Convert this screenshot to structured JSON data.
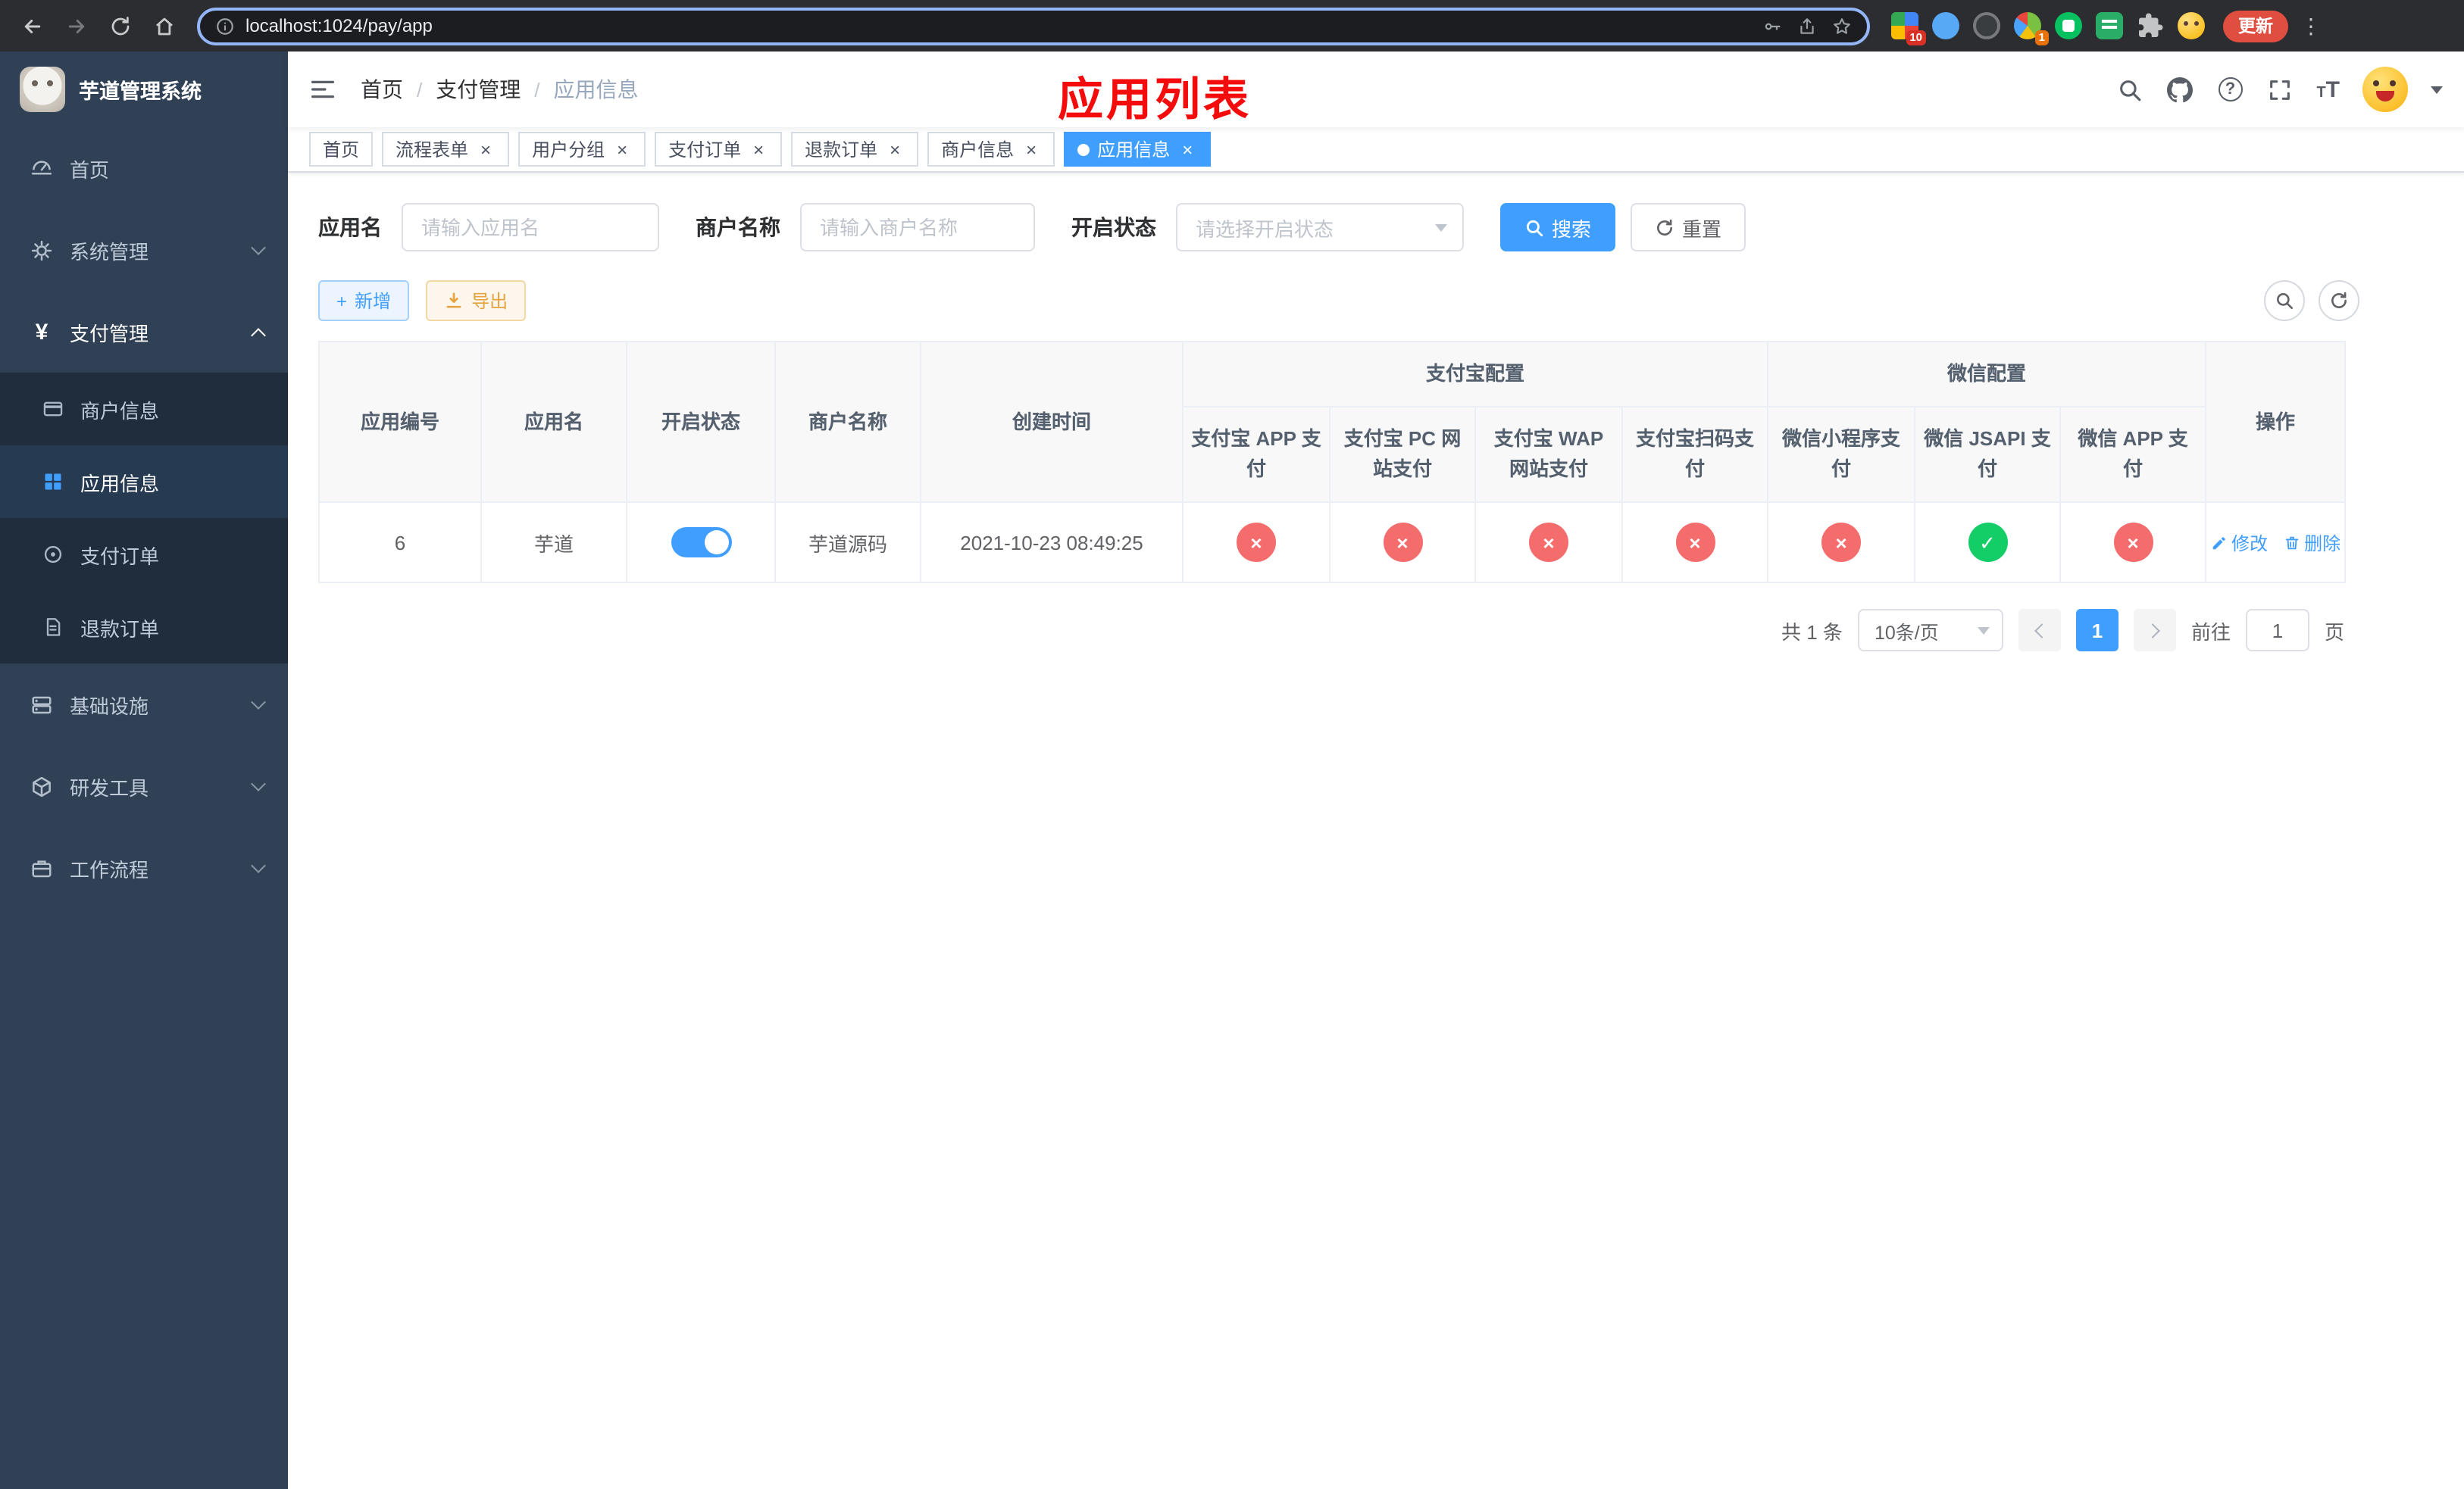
{
  "colors": {
    "accent": "#409eff",
    "danger": "#f56c6c",
    "success": "#13ce66",
    "warning": "#e6a23c",
    "annotation_red": "#f40b0b",
    "sidebar_bg": "#304156",
    "submenu_bg": "#1f2d3d"
  },
  "browser": {
    "url": "localhost:1024/pay/app",
    "update_button": "更新",
    "grid_ext_badge": "10",
    "circle_ext_badge": "1"
  },
  "sidebar": {
    "title": "芋道管理系统",
    "menu": [
      {
        "label": "首页",
        "icon": "dashboard-icon"
      },
      {
        "label": "系统管理",
        "icon": "gear-icon"
      },
      {
        "label": "支付管理",
        "icon": "yen-icon",
        "expanded": true
      },
      {
        "label": "基础设施",
        "icon": "infra-icon"
      },
      {
        "label": "研发工具",
        "icon": "tools-icon"
      },
      {
        "label": "工作流程",
        "icon": "workflow-icon"
      }
    ],
    "submenu": [
      {
        "label": "商户信息",
        "icon": "merchant-card-icon",
        "active": false
      },
      {
        "label": "应用信息",
        "icon": "app-grid-icon",
        "active": true
      },
      {
        "label": "支付订单",
        "icon": "order-icon",
        "active": false
      },
      {
        "label": "退款订单",
        "icon": "refund-doc-icon",
        "active": false
      }
    ]
  },
  "navbar": {
    "breadcrumb": [
      "首页",
      "支付管理",
      "应用信息"
    ],
    "annotation_title": "应用列表"
  },
  "tabs": [
    {
      "label": "首页",
      "closable": false,
      "active": false
    },
    {
      "label": "流程表单",
      "closable": true,
      "active": false
    },
    {
      "label": "用户分组",
      "closable": true,
      "active": false
    },
    {
      "label": "支付订单",
      "closable": true,
      "active": false
    },
    {
      "label": "退款订单",
      "closable": true,
      "active": false
    },
    {
      "label": "商户信息",
      "closable": true,
      "active": false
    },
    {
      "label": "应用信息",
      "closable": true,
      "active": true
    }
  ],
  "filters": {
    "app_name": {
      "label": "应用名",
      "placeholder": "请输入应用名"
    },
    "merchant_name": {
      "label": "商户名称",
      "placeholder": "请输入商户名称"
    },
    "status": {
      "label": "开启状态",
      "placeholder": "请选择开启状态"
    },
    "search_button": "搜索",
    "reset_button": "重置"
  },
  "toolbar": {
    "add_button": "新增",
    "export_button": "导出"
  },
  "table": {
    "headers": {
      "app_id": "应用编号",
      "app_name": "应用名",
      "status": "开启状态",
      "merchant": "商户名称",
      "created": "创建时间",
      "alipay_group": "支付宝配置",
      "wechat_group": "微信配置",
      "alipay_app": "支付宝 APP 支付",
      "alipay_pc": "支付宝 PC 网站支付",
      "alipay_wap": "支付宝 WAP 网站支付",
      "alipay_qr": "支付宝扫码支付",
      "wx_lite": "微信小程序支付",
      "wx_jsapi": "微信 JSAPI 支付",
      "wx_app": "微信 APP 支付",
      "actions": "操作"
    },
    "rows": [
      {
        "id": "6",
        "name": "芋道",
        "enabled": true,
        "merchant": "芋道源码",
        "created": "2021-10-23 08:49:25",
        "config": {
          "alipay_app": false,
          "alipay_pc": false,
          "alipay_wap": false,
          "alipay_qr": false,
          "wx_lite": false,
          "wx_jsapi": true,
          "wx_app": false
        },
        "actions": {
          "edit": "修改",
          "delete": "删除"
        }
      }
    ]
  },
  "pagination": {
    "total_text": "共 1 条",
    "page_size": "10条/页",
    "current_page": "1",
    "goto_label": "前往",
    "goto_value": "1",
    "unit_label": "页"
  }
}
